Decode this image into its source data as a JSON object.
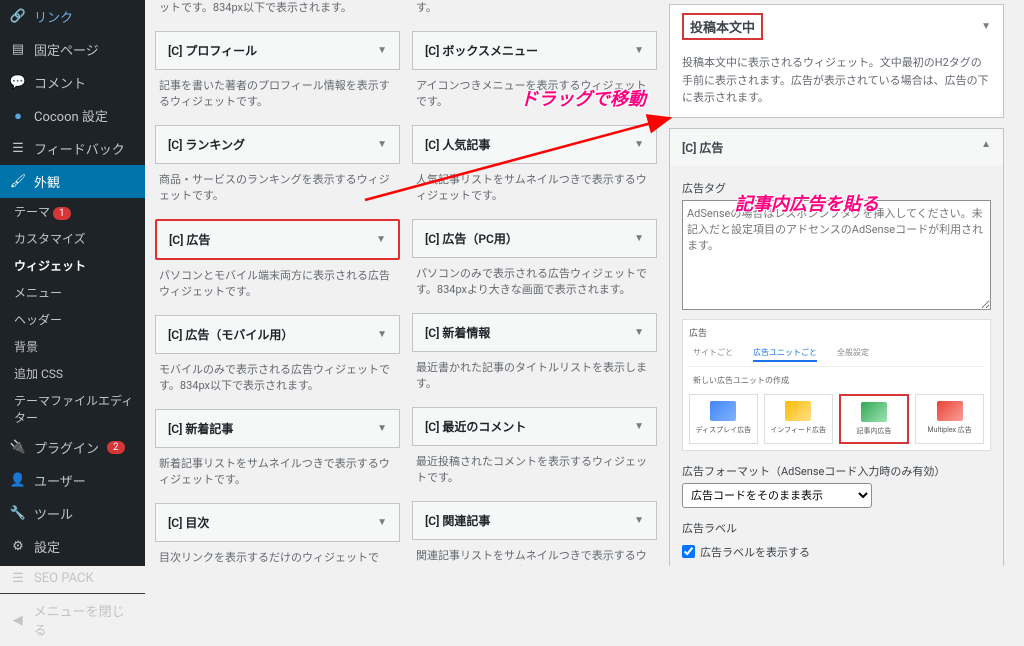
{
  "sidebar": {
    "link": "リンク",
    "pages": "固定ページ",
    "comments": "コメント",
    "cocoon": "Cocoon 設定",
    "feedback": "フィードバック",
    "appearance": "外観",
    "themes": "テーマ",
    "customize": "カスタマイズ",
    "widgets": "ウィジェット",
    "menus": "メニュー",
    "header": "ヘッダー",
    "background": "背景",
    "css": "追加 CSS",
    "editor": "テーマファイルエディター",
    "plugins": "プラグイン",
    "users": "ユーザー",
    "tools": "ツール",
    "settings": "設定",
    "seopack": "SEO PACK",
    "collapse": "メニューを閉じる",
    "theme_badge": "1",
    "plugin_badge": "2"
  },
  "widgets_left": [
    {
      "title": "",
      "desc": "ットです。834px以下で表示されます。",
      "head_only": false,
      "desc_only": true
    },
    {
      "title": "[C] プロフィール",
      "desc": "記事を書いた著者のプロフィール情報を表示するウィジェットです。"
    },
    {
      "title": "[C] ランキング",
      "desc": "商品・サービスのランキングを表示するウィジェットです。"
    },
    {
      "title": "[C] 広告",
      "desc": "パソコンとモバイル端末両方に表示される広告ウィジェットです。",
      "highlight": true
    },
    {
      "title": "[C] 広告（モバイル用）",
      "desc": "モバイルのみで表示される広告ウィジェットです。834px以下で表示されます。"
    },
    {
      "title": "[C] 新着記事",
      "desc": "新着記事リストをサムネイルつきで表示するウィジェットです。"
    },
    {
      "title": "[C] 目次",
      "desc": "目次リンクを表示するだけのウィジェットです。"
    }
  ],
  "widgets_mid": [
    {
      "title": "",
      "desc": "す。",
      "desc_only": true
    },
    {
      "title": "[C] ボックスメニュー",
      "desc": "アイコンつきメニューを表示するウィジェットです。"
    },
    {
      "title": "[C] 人気記事",
      "desc": "人気記事リストをサムネイルつきで表示するウィジェットです。"
    },
    {
      "title": "[C] 広告（PC用）",
      "desc": "パソコンのみで表示される広告ウィジェットです。834pxより大きな画面で表示されます。"
    },
    {
      "title": "[C] 新着情報",
      "desc": "最近書かれた記事のタイトルリストを表示します。"
    },
    {
      "title": "[C] 最近のコメント",
      "desc": "最近投稿されたコメントを表示するウィジェットです。"
    },
    {
      "title": "[C] 関連記事",
      "desc": "関連記事リストをサムネイルつきで表示するウィジェットです。投稿ページのみ表示されます。"
    }
  ],
  "area": {
    "title": "投稿本文中",
    "desc": "投稿本文中に表示されるウィジェット。文中最初のH2タグの手前に表示されます。広告が表示されている場合は、広告の下に表示されます。",
    "widget_title": "[C] 広告",
    "adtag_label": "広告タグ",
    "adtag_placeholder": "AdSenseの場合はレスポンシブタグを挿入してください。未記入だと設定項目のアドセンスのAdSenseコードが利用されます。",
    "preview": {
      "header": "広告",
      "tab1": "サイトごと",
      "tab2": "広告ユニットごと",
      "tab3": "全般設定",
      "section": "新しい広告ユニットの作成",
      "cards": [
        "ディスプレイ広告",
        "インフィード広告",
        "記事内広告",
        "Multiplex 広告"
      ]
    },
    "format_label": "広告フォーマット（AdSenseコード入力時のみ有効）",
    "format_value": "広告コードをそのまま表示",
    "adlabel_label": "広告ラベル",
    "adlabel_check": "広告ラベルを表示する"
  },
  "annotations": {
    "drag": "ドラッグで移動",
    "paste": "記事内広告を貼る"
  }
}
